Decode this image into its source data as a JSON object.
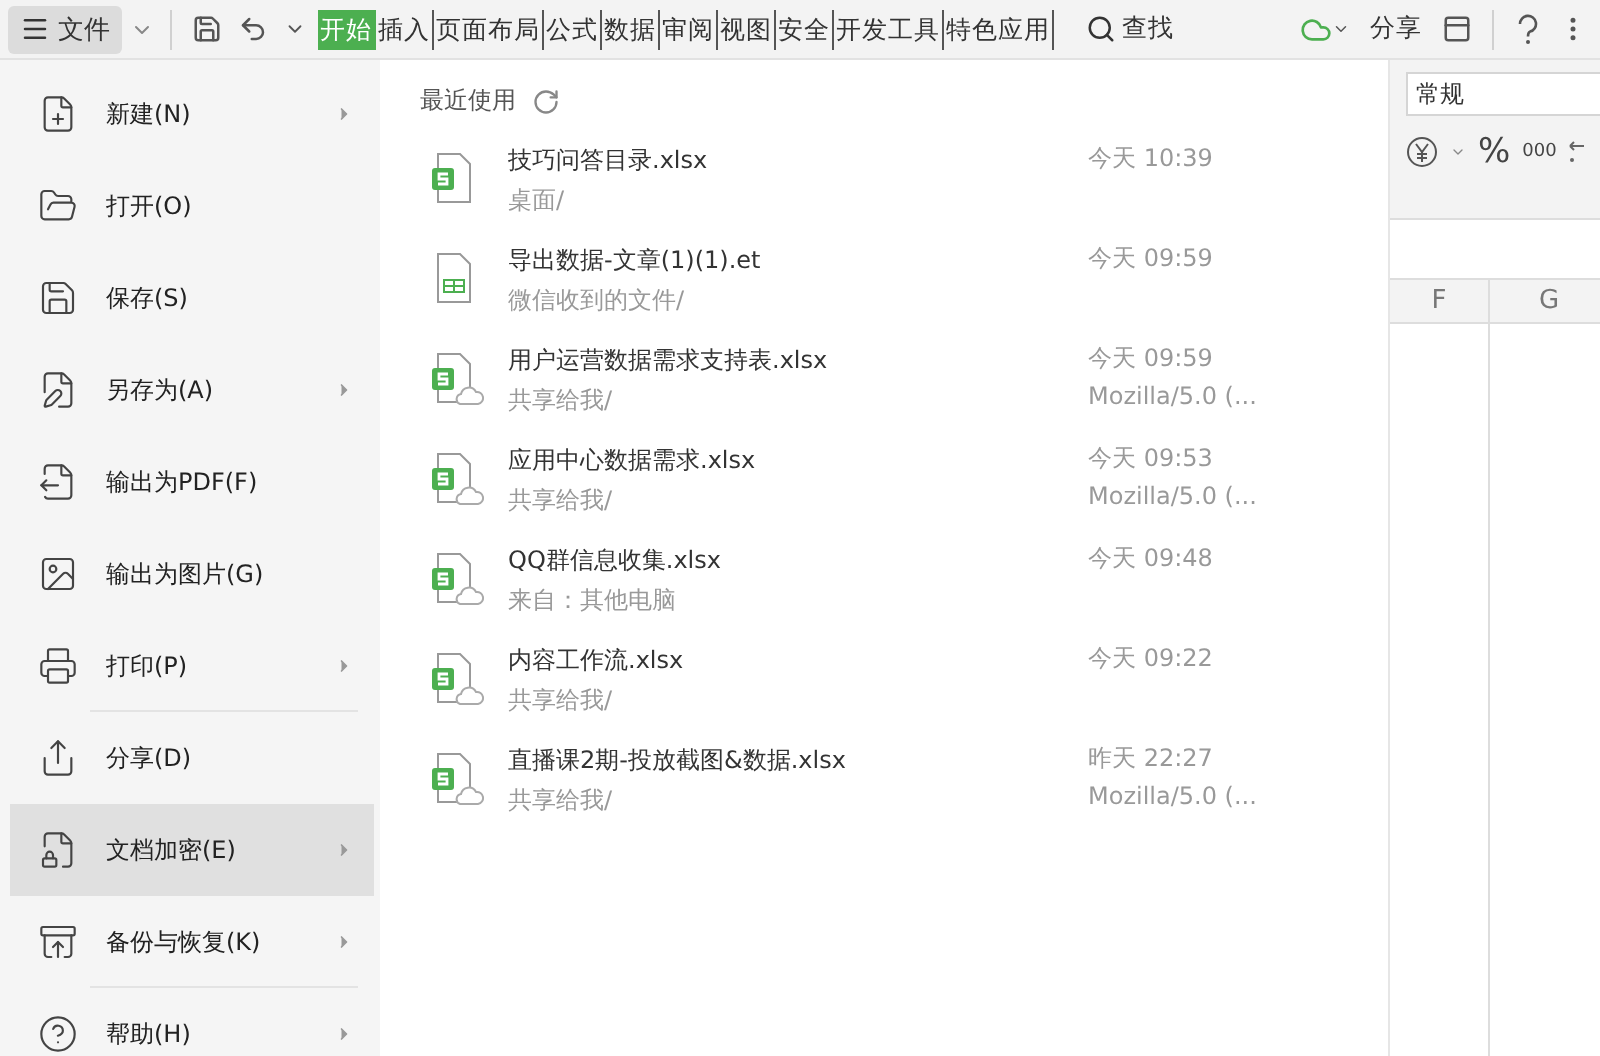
{
  "toolbar": {
    "file_button": "文件",
    "tabs": [
      {
        "label": "开始",
        "selected": true
      },
      {
        "label": "插入",
        "selected": false
      },
      {
        "label": "页面布局",
        "selected": false
      },
      {
        "label": "公式",
        "selected": false
      },
      {
        "label": "数据",
        "selected": false
      },
      {
        "label": "审阅",
        "selected": false
      },
      {
        "label": "视图",
        "selected": false
      },
      {
        "label": "安全",
        "selected": false
      },
      {
        "label": "开发工具",
        "selected": false
      },
      {
        "label": "特色应用",
        "selected": false
      }
    ],
    "search": "查找",
    "share": "分享"
  },
  "file_menu": {
    "items": [
      {
        "label": "新建(N)",
        "submenu": true,
        "selected": false,
        "divider_after": false
      },
      {
        "label": "打开(O)",
        "submenu": false,
        "selected": false,
        "divider_after": false
      },
      {
        "label": "保存(S)",
        "submenu": false,
        "selected": false,
        "divider_after": false
      },
      {
        "label": "另存为(A)",
        "submenu": true,
        "selected": false,
        "divider_after": false
      },
      {
        "label": "输出为PDF(F)",
        "submenu": false,
        "selected": false,
        "divider_after": false
      },
      {
        "label": "输出为图片(G)",
        "submenu": false,
        "selected": false,
        "divider_after": false
      },
      {
        "label": "打印(P)",
        "submenu": true,
        "selected": false,
        "divider_after": true
      },
      {
        "label": "分享(D)",
        "submenu": false,
        "selected": false,
        "divider_after": false
      },
      {
        "label": "文档加密(E)",
        "submenu": true,
        "selected": true,
        "divider_after": false
      },
      {
        "label": "备份与恢复(K)",
        "submenu": true,
        "selected": false,
        "divider_after": true
      },
      {
        "label": "帮助(H)",
        "submenu": true,
        "selected": false,
        "divider_after": false
      }
    ]
  },
  "recent": {
    "title": "最近使用",
    "files": [
      {
        "name": "技巧问答目录.xlsx",
        "location": "桌面/",
        "time": "今天 10:39",
        "kind": "spreadsheet",
        "shared": false
      },
      {
        "name": "导出数据-文章(1)(1).et",
        "location": "微信收到的文件/",
        "time": "今天 09:59",
        "kind": "table",
        "shared": false
      },
      {
        "name": "用户运营数据需求支持表.xlsx",
        "location": "共享给我/",
        "time": "今天 09:59",
        "source": "Mozilla/5.0 (...",
        "kind": "spreadsheet",
        "shared": true
      },
      {
        "name": "应用中心数据需求.xlsx",
        "location": "共享给我/",
        "time": "今天 09:53",
        "source": "Mozilla/5.0 (...",
        "kind": "spreadsheet",
        "shared": true
      },
      {
        "name": "QQ群信息收集.xlsx",
        "location": "来自：其他电脑",
        "time": "今天 09:48",
        "kind": "spreadsheet",
        "shared": true
      },
      {
        "name": "内容工作流.xlsx",
        "location": "共享给我/",
        "time": "今天 09:22",
        "kind": "spreadsheet",
        "shared": true
      },
      {
        "name": "直播课2期-投放截图&数据.xlsx",
        "location": "共享给我/",
        "time": "昨天 22:27",
        "source": "Mozilla/5.0 (...",
        "kind": "spreadsheet",
        "shared": true
      }
    ]
  },
  "sheet": {
    "number_format": "常规",
    "format_buttons": [
      "%",
      "000"
    ],
    "columns": [
      "F",
      "G"
    ]
  }
}
